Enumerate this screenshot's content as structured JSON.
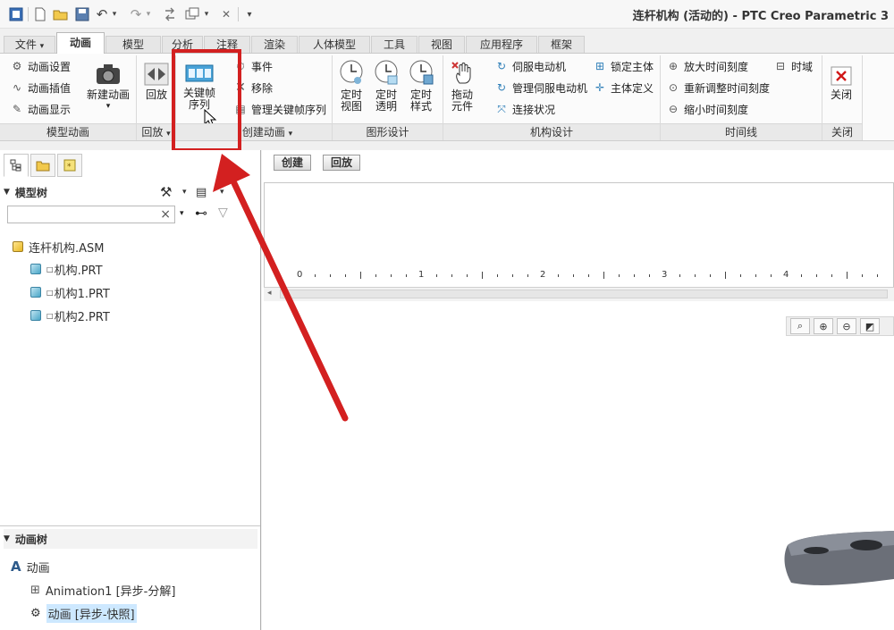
{
  "window": {
    "title": "连杆机构 (活动的) - PTC Creo Parametric 3"
  },
  "quick_access": [
    {
      "icon": "app-menu-icon",
      "glyph": "▣"
    },
    {
      "icon": "new-file-icon",
      "glyph": "🗋"
    },
    {
      "icon": "open-folder-icon",
      "glyph": "📂"
    },
    {
      "icon": "save-icon",
      "glyph": "💾"
    },
    {
      "icon": "undo-icon",
      "glyph": "↶"
    },
    {
      "icon": "redo-icon",
      "glyph": "↷"
    },
    {
      "icon": "regenerate-icon",
      "glyph": "⇆"
    },
    {
      "icon": "windows-icon",
      "glyph": "⧉"
    },
    {
      "icon": "close-window-icon",
      "glyph": "✕"
    },
    {
      "icon": "customize-toolbar-icon",
      "glyph": "▾"
    }
  ],
  "tabs": [
    "文件",
    "动画",
    "模型",
    "分析",
    "注释",
    "渲染",
    "人体模型",
    "工具",
    "视图",
    "应用程序",
    "框架"
  ],
  "tabs_file_arrow": "▾",
  "ribbon": {
    "model_animation": {
      "items": [
        "动画设置",
        "动画插值",
        "动画显示"
      ],
      "new_animation": "新建动画",
      "group_label": "模型动画"
    },
    "playback": {
      "label": "回放",
      "group_label": "回放"
    },
    "create_animation": {
      "keyframe_seq_line1": "关键帧",
      "keyframe_seq_line2": "序列",
      "items": [
        "事件",
        "移除",
        "管理关键帧序列"
      ],
      "group_label": "创建动画"
    },
    "graphic_design": {
      "buttons": [
        {
          "line1": "定时",
          "line2": "视图"
        },
        {
          "line1": "定时",
          "line2": "透明"
        },
        {
          "line1": "定时",
          "line2": "样式"
        }
      ],
      "group_label": "图形设计"
    },
    "mechanism_design": {
      "drag_line1": "拖动",
      "drag_line2": "元件",
      "col1": [
        "伺服电动机",
        "管理伺服电动机",
        "连接状况"
      ],
      "col2": [
        "锁定主体",
        "主体定义"
      ],
      "group_label": "机构设计"
    },
    "timeline": {
      "items": [
        "放大时间刻度",
        "重新调整时间刻度",
        "缩小时间刻度"
      ],
      "time_domain": "时域",
      "group_label": "时间线"
    },
    "close": {
      "label": "关闭",
      "group_label": "关闭"
    }
  },
  "model_tree": {
    "header": "模型树",
    "search_clear": "×",
    "items": [
      {
        "label": "连杆机构.ASM",
        "level": 0
      },
      {
        "label": "机构.PRT",
        "level": 1
      },
      {
        "label": "机构1.PRT",
        "level": 1
      },
      {
        "label": "机构2.PRT",
        "level": 1
      }
    ]
  },
  "animation_tree": {
    "header": "动画树",
    "root": "动画",
    "items": [
      "Animation1 [异步-分解]",
      "动画 [异步-快照]"
    ]
  },
  "timeline_area": {
    "create_btn": "创建",
    "playback_btn": "回放",
    "ruler_labels": [
      "0",
      "1",
      "2",
      "3",
      "4"
    ]
  },
  "colors": {
    "highlight": "#d32020",
    "arrow": "#d32020",
    "selected_row": "#cde8ff"
  }
}
